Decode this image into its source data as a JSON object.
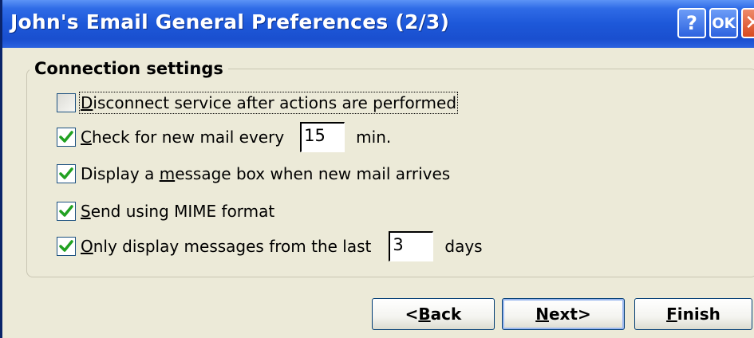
{
  "window": {
    "title": "John's Email General Preferences (2/3)",
    "titlebar_buttons": [
      {
        "label": "?",
        "icon": "help-icon"
      },
      {
        "label": "OK",
        "icon": "ok-icon"
      },
      {
        "label": "✕",
        "icon": "close-icon"
      }
    ]
  },
  "group": {
    "legend": "Connection settings"
  },
  "options": [
    {
      "pre": "",
      "accel": "D",
      "post": "isconnect service after actions are performed",
      "checked": false
    },
    {
      "pre": "",
      "accel": "C",
      "post": "heck for new mail every",
      "checked": true,
      "value": "15",
      "suffix": "min."
    },
    {
      "pre": "Display a ",
      "accel": "m",
      "post": "essage box when new mail arrives",
      "checked": true
    },
    {
      "pre": "",
      "accel": "S",
      "post": "end using MIME format",
      "checked": true
    },
    {
      "pre": "",
      "accel": "O",
      "post": "nly display messages from the last",
      "checked": true,
      "value": "3",
      "suffix": "days"
    }
  ],
  "buttons": {
    "back": {
      "pre": "<",
      "accel": "B",
      "post": "ack"
    },
    "next": {
      "pre": "",
      "accel": "N",
      "post": "ext>"
    },
    "finish": {
      "pre": "",
      "accel": "F",
      "post": "inish"
    }
  },
  "colors": {
    "titlebar": "#1d58d9",
    "window_bg": "#ecead8",
    "check": "#21a121",
    "close": "#d8491f"
  }
}
